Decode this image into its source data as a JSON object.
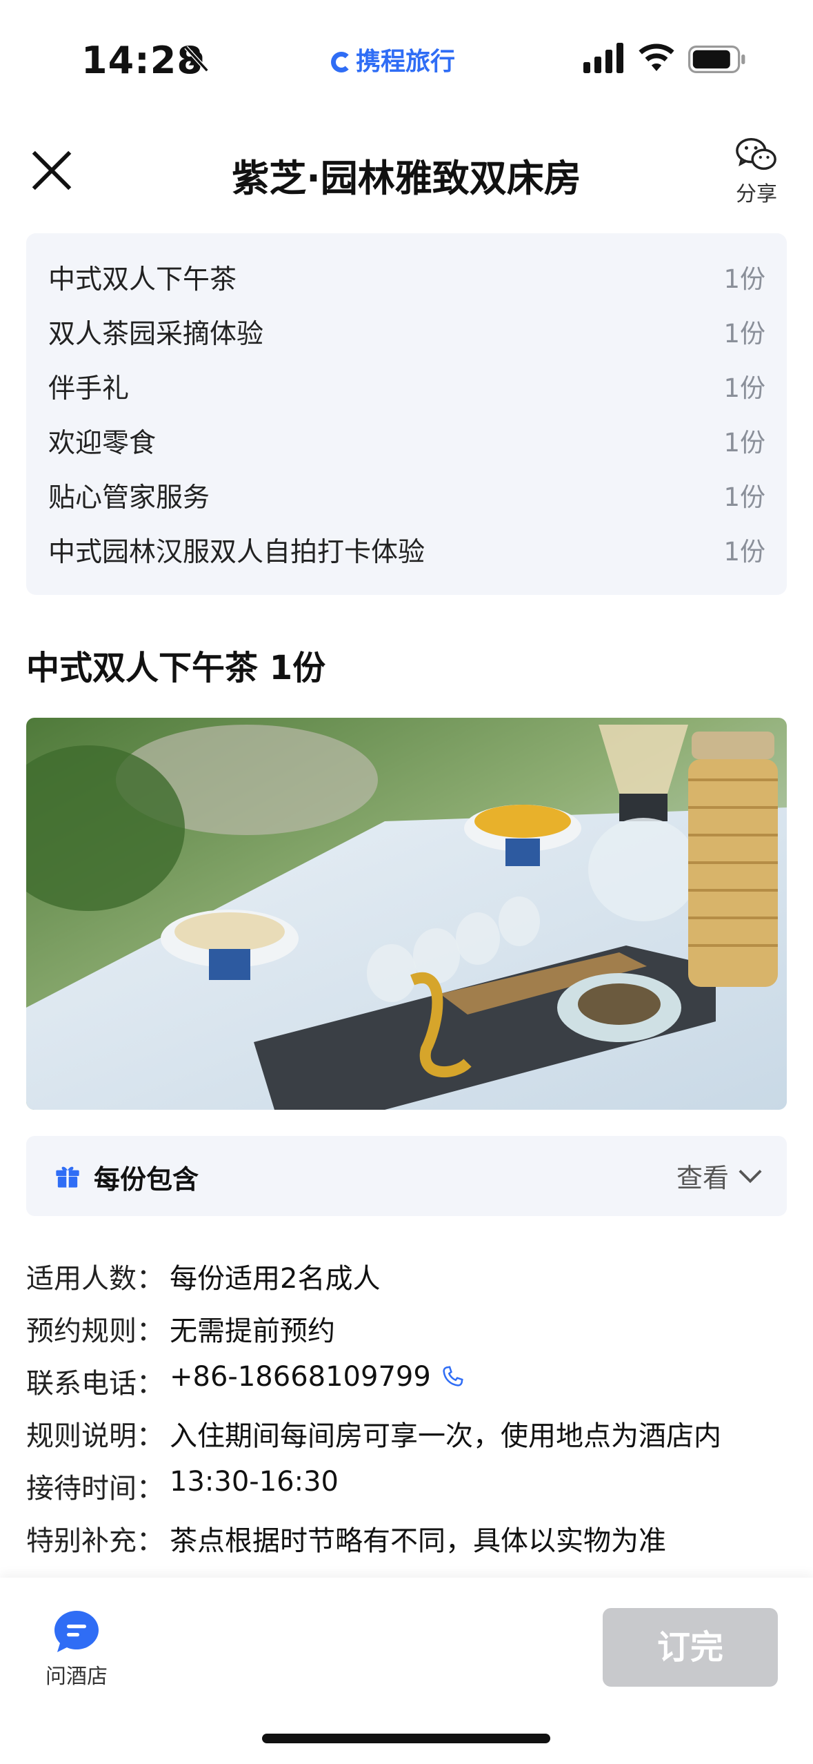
{
  "status_bar": {
    "time": "14:28",
    "brand": "携程旅行",
    "icons": [
      "bell-off-icon",
      "cellular-signal-icon",
      "wifi-icon",
      "battery-icon"
    ]
  },
  "header": {
    "title": "紫芝·园林雅致双床房",
    "share_label": "分享"
  },
  "package_items": [
    {
      "name": "中式双人下午茶",
      "qty": "1份"
    },
    {
      "name": "双人茶园采摘体验",
      "qty": "1份"
    },
    {
      "name": "伴手礼",
      "qty": "1份"
    },
    {
      "name": "欢迎零食",
      "qty": "1份"
    },
    {
      "name": "贴心管家服务",
      "qty": "1份"
    },
    {
      "name": "中式园林汉服双人自拍打卡体验",
      "qty": "1份"
    }
  ],
  "section": {
    "title": "中式双人下午茶 1份",
    "includes_label": "每份包含",
    "view_label": "查看"
  },
  "details": [
    {
      "key": "适用人数：",
      "value": "每份适用2名成人"
    },
    {
      "key": "预约规则：",
      "value": "无需提前预约"
    },
    {
      "key": "联系电话：",
      "value": "+86-18668109799"
    },
    {
      "key": "规则说明：",
      "value": "入住期间每间房可享一次，使用地点为酒店内"
    },
    {
      "key": "接待时间：",
      "value": "13:30-16:30"
    },
    {
      "key": "特别补充：",
      "value": "茶点根据时节略有不同，具体以实物为准"
    }
  ],
  "bottom_bar": {
    "ask_label": "问酒店",
    "book_label": "订完"
  },
  "colors": {
    "accent": "#2f6df5",
    "panel_bg": "#f3f5fa",
    "disabled_button": "#c8c9cc"
  }
}
